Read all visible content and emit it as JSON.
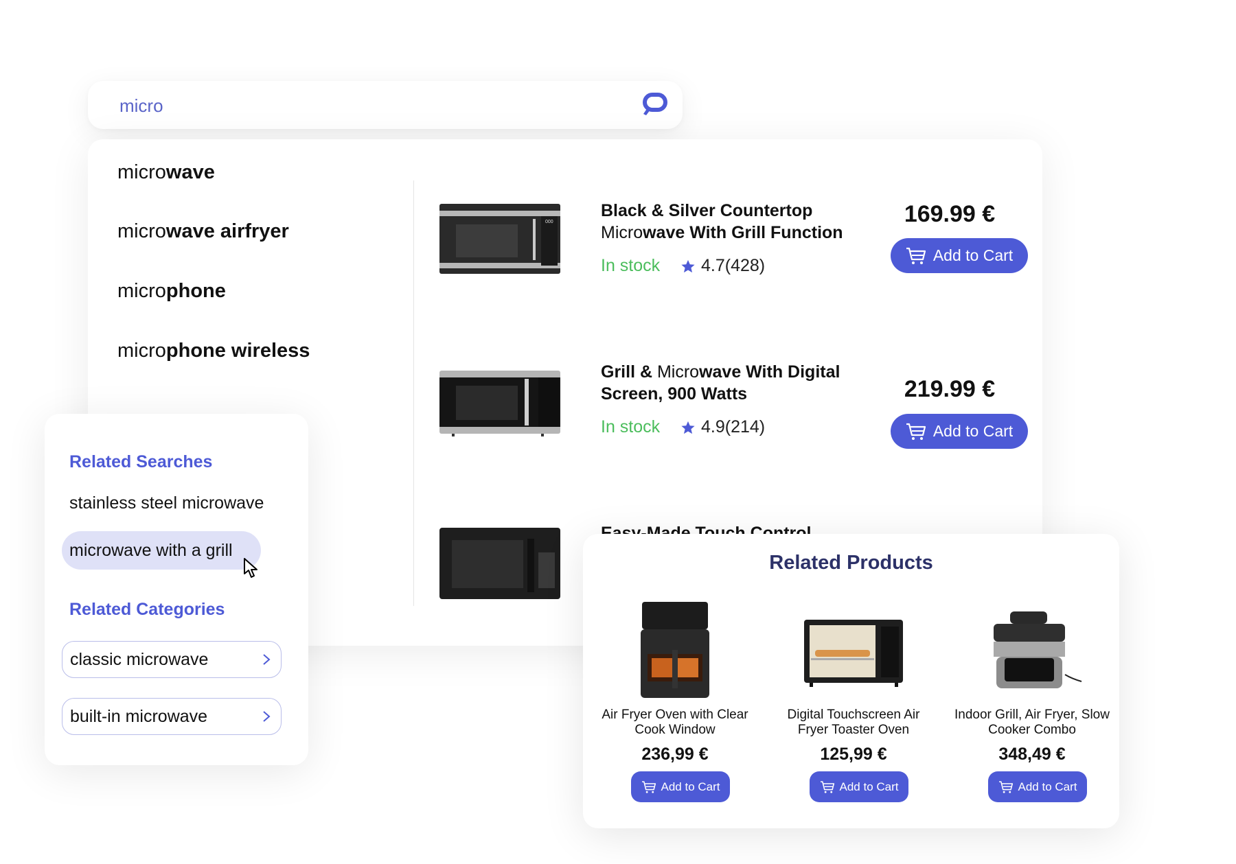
{
  "search": {
    "value": "micro",
    "icon": "search-icon"
  },
  "suggestions": [
    {
      "prefix": "micro",
      "completion": "wave"
    },
    {
      "prefix": "micro",
      "completion": "wave airfryer"
    },
    {
      "prefix": "micro",
      "completion": "phone"
    },
    {
      "prefix": "micro",
      "completion": "phone wireless"
    }
  ],
  "products": [
    {
      "title_pre": "Black & Silver Countertop",
      "title_light": "Micro",
      "title_post": "wave With Grill Function",
      "stock": "In stock",
      "rating": "4.7",
      "reviews": "(428)",
      "price": "169.99 €",
      "cart_label": "Add to Cart"
    },
    {
      "title_pre": "Grill &",
      "title_light": "Micro",
      "title_post": "wave With Digital Screen, 900 Watts",
      "stock": "In stock",
      "rating": "4.9",
      "reviews": "(214)",
      "price": "219.99 €",
      "cart_label": "Add to Cart"
    },
    {
      "title_pre": "Easy-Made Touch Control",
      "title_light": "",
      "title_post": ""
    }
  ],
  "related_searches": {
    "title": "Related Searches",
    "items": [
      "stainless steel microwave",
      "microwave with a grill"
    ]
  },
  "related_categories": {
    "title": "Related Categories",
    "items": [
      "classic microwave",
      "built-in microwave"
    ]
  },
  "related_products": {
    "title": "Related Products",
    "items": [
      {
        "name": "Air Fryer Oven with Clear Cook Window",
        "price": "236,99 €",
        "cart_label": "Add to Cart"
      },
      {
        "name": "Digital Touchscreen Air Fryer Toaster Oven",
        "price": "125,99 €",
        "cart_label": "Add to Cart"
      },
      {
        "name": "Indoor Grill, Air Fryer, Slow Cooker Combo",
        "price": "348,49 €",
        "cart_label": "Add to Cart"
      }
    ]
  },
  "colors": {
    "accent": "#4d5ad6",
    "in_stock": "#4bbd5c",
    "highlight": "#dfe1f7",
    "title_dark": "#2c3168"
  }
}
